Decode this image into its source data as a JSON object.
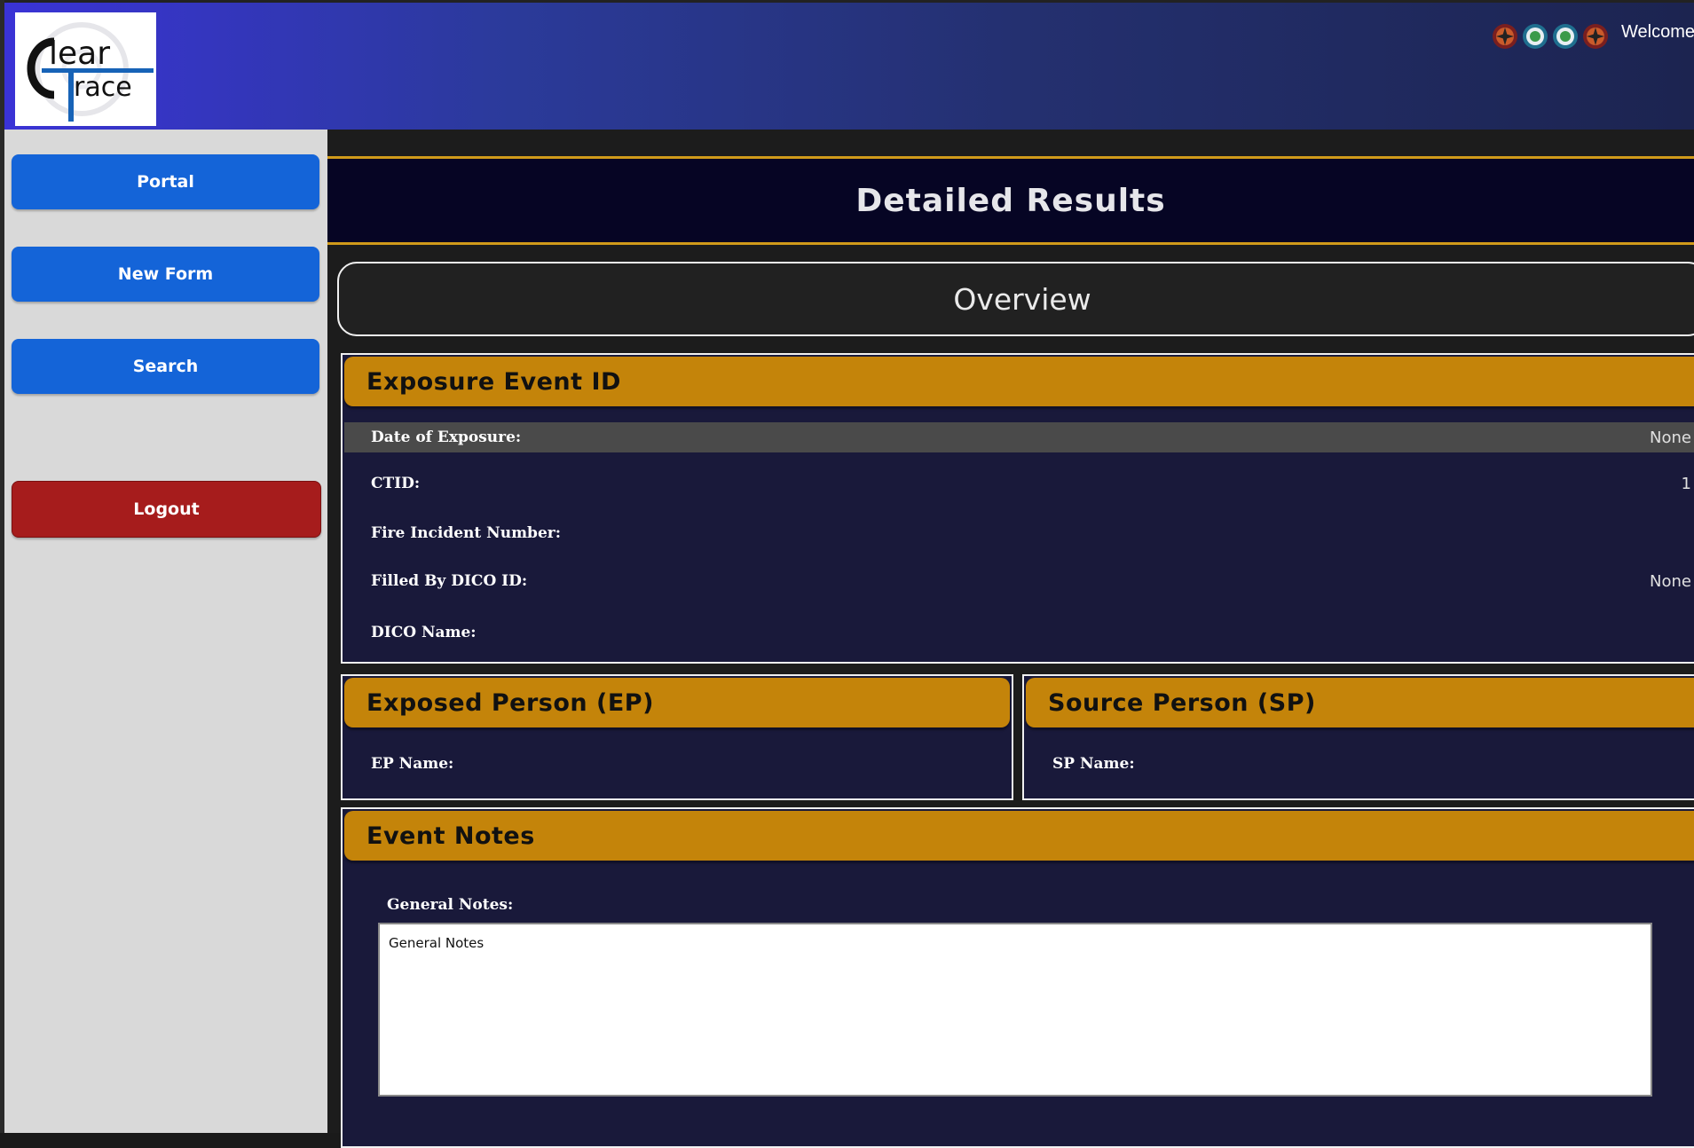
{
  "app": {
    "logo_text": "Clear Trace",
    "welcome_text": "Welcome,",
    "header_icons": [
      "fire-department-badge-icon",
      "city-seal-icon",
      "city-seal-icon",
      "fire-department-badge-icon"
    ]
  },
  "sidebar": {
    "portal_label": "Portal",
    "new_form_label": "New Form",
    "search_label": "Search",
    "logout_label": "Logout"
  },
  "page": {
    "title": "Detailed Results",
    "overview_label": "Overview"
  },
  "exposure_event": {
    "header": "Exposure Event ID",
    "rows": [
      {
        "label": "Date of Exposure:",
        "value": "None"
      },
      {
        "label": "CTID:",
        "value": "1"
      },
      {
        "label": "Fire Incident Number:",
        "value": ""
      },
      {
        "label": "Filled By DICO ID:",
        "value": "None"
      },
      {
        "label": "DICO Name:",
        "value": ""
      }
    ]
  },
  "exposed_person": {
    "header": "Exposed Person (EP)",
    "name_label": "EP Name:",
    "name_value": ""
  },
  "source_person": {
    "header": "Source Person (SP)",
    "name_label": "SP Name:",
    "name_value": ""
  },
  "event_notes": {
    "header": "Event Notes",
    "general_notes_label": "General Notes:",
    "general_notes_value": "General Notes"
  },
  "colors": {
    "header_gradient_start": "#3a33d6",
    "nav_button": "#1464d8",
    "logout_button": "#a61c1c",
    "section_header": "#c4840a",
    "panel_bg": "#19193a",
    "title_bar_bg": "#060524",
    "accent_line": "#d09a1a"
  }
}
